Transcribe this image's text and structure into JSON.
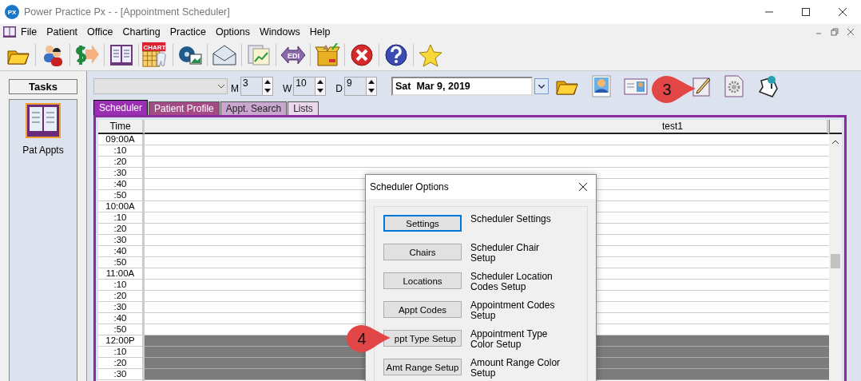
{
  "window": {
    "title": "Power Practice Px -  - [Appointment Scheduler]",
    "app_badge": "PX"
  },
  "menu": [
    "File",
    "Patient",
    "Office",
    "Charting",
    "Practice",
    "Options",
    "Windows",
    "Help"
  ],
  "toolbar": {
    "chart_icon_text": "CHART",
    "edi_icon_text": "EDI"
  },
  "tasks": {
    "title": "Tasks",
    "items": [
      {
        "label": "Pat Appts",
        "selected": true
      }
    ]
  },
  "controls": {
    "provider": {
      "disabled": true
    },
    "spinners": [
      {
        "label": "M",
        "value": "3"
      },
      {
        "label": "W",
        "value": "10"
      },
      {
        "label": "D",
        "value": "9"
      }
    ],
    "date": "Sat  Mar 9, 2019"
  },
  "tabs": [
    {
      "label": "Scheduler",
      "selected": true,
      "color": "#9a2fb3"
    },
    {
      "label": "Patient Profile",
      "selected": false,
      "color": "#a44b86"
    },
    {
      "label": "Appt. Search",
      "selected": false,
      "color": "#c9a7cf"
    },
    {
      "label": "Lists",
      "selected": false,
      "color": "#ecd8ec"
    }
  ],
  "grid": {
    "columns": [
      "Time",
      "test1"
    ],
    "rows": [
      {
        "time": "09:00A",
        "blocked": false
      },
      {
        "time": ":10",
        "blocked": false
      },
      {
        "time": ":20",
        "blocked": false
      },
      {
        "time": ":30",
        "blocked": false
      },
      {
        "time": ":40",
        "blocked": false
      },
      {
        "time": ":50",
        "blocked": false
      },
      {
        "time": "10:00A",
        "blocked": false
      },
      {
        "time": ":10",
        "blocked": false
      },
      {
        "time": ":20",
        "blocked": false
      },
      {
        "time": ":30",
        "blocked": false
      },
      {
        "time": ":40",
        "blocked": false
      },
      {
        "time": ":50",
        "blocked": false
      },
      {
        "time": "11:00A",
        "blocked": false
      },
      {
        "time": ":10",
        "blocked": false
      },
      {
        "time": ":20",
        "blocked": false
      },
      {
        "time": ":30",
        "blocked": false
      },
      {
        "time": ":40",
        "blocked": false
      },
      {
        "time": ":50",
        "blocked": false
      },
      {
        "time": "12:00P",
        "blocked": true
      },
      {
        "time": ":10",
        "blocked": true
      },
      {
        "time": ":20",
        "blocked": true
      },
      {
        "time": ":30",
        "blocked": true
      }
    ]
  },
  "dialog": {
    "title": "Scheduler Options",
    "options": [
      {
        "button": "Settings",
        "description": "Scheduler Settings",
        "focused": true
      },
      {
        "button": "Chairs",
        "description": "Scheduler Chair Setup",
        "focused": false
      },
      {
        "button": "Locations",
        "description": "Scheduler Location Codes Setup",
        "focused": false
      },
      {
        "button": "Appt Codes",
        "description": "Appointment Codes Setup",
        "focused": false
      },
      {
        "button": "ppt Type Setup",
        "description": "Appointment Type Color Setup",
        "focused": false
      },
      {
        "button": "Amt Range Setup",
        "description": "Amount Range Color Setup",
        "focused": false
      }
    ]
  },
  "callouts": [
    {
      "label": "3"
    },
    {
      "label": "4"
    }
  ]
}
